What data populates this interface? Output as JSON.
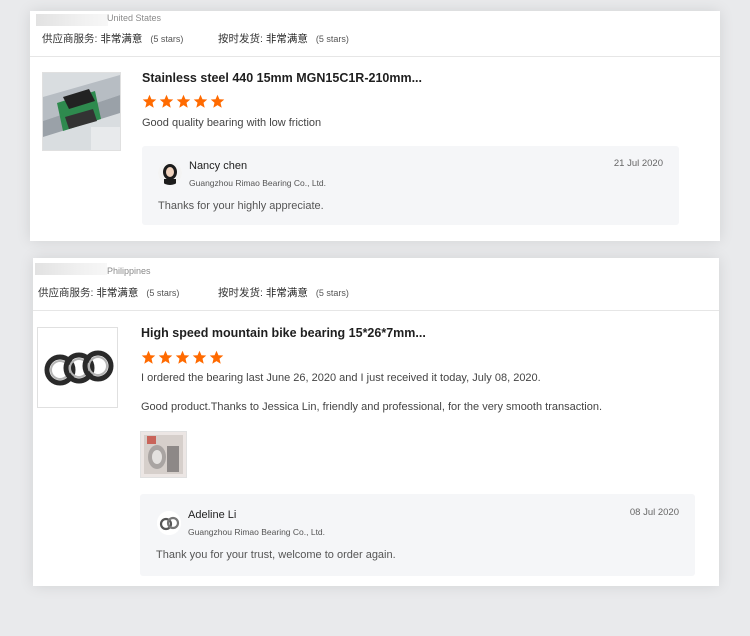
{
  "reviews": [
    {
      "country": "United States",
      "supplier_service": {
        "label": "供应商服务:",
        "value": "非常满意",
        "stars": "(5 stars)"
      },
      "on_time_shipment": {
        "label": "按时发货:",
        "value": "非常满意",
        "stars": "(5 stars)"
      },
      "product_title": "Stainless steel 440 15mm MGN15C1R-210mm...",
      "rating": 5,
      "comments": [
        "Good quality bearing with low friction"
      ],
      "reply": {
        "name": "Nancy chen",
        "company": "Guangzhou Rimao Bearing Co., Ltd.",
        "date": "21 Jul 2020",
        "text": "Thanks for your highly appreciate."
      }
    },
    {
      "country": "Philippines",
      "supplier_service": {
        "label": "供应商服务:",
        "value": "非常满意",
        "stars": "(5 stars)"
      },
      "on_time_shipment": {
        "label": "按时发货:",
        "value": "非常满意",
        "stars": "(5 stars)"
      },
      "product_title": "High speed mountain bike bearing 15*26*7mm...",
      "rating": 5,
      "comments": [
        "I ordered the bearing last June 26, 2020 and I just received it today, July 08, 2020.",
        "Good product.Thanks to Jessica Lin, friendly and professional, for the very smooth transaction."
      ],
      "reply": {
        "name": "Adeline Li",
        "company": "Guangzhou Rimao Bearing Co., Ltd.",
        "date": "08 Jul 2020",
        "text": "Thank you for your trust, welcome to order again."
      }
    }
  ],
  "colors": {
    "star": "#ff6a00",
    "reply_bg": "#f5f6f8",
    "page_bg": "#e9eaec"
  }
}
